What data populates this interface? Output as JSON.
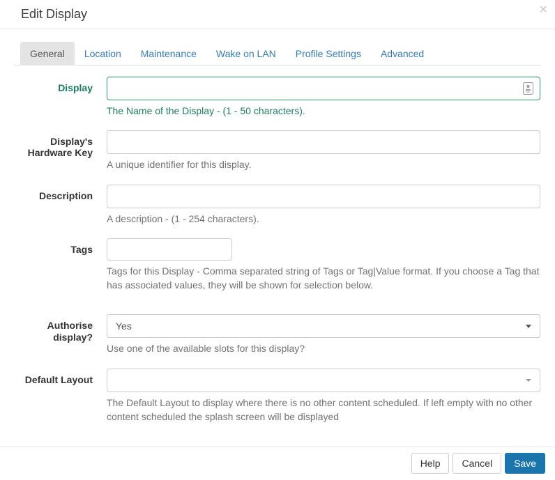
{
  "modal": {
    "title": "Edit Display",
    "close_glyph": "×"
  },
  "tabs": [
    {
      "label": "General",
      "active": true
    },
    {
      "label": "Location",
      "active": false
    },
    {
      "label": "Maintenance",
      "active": false
    },
    {
      "label": "Wake on LAN",
      "active": false
    },
    {
      "label": "Profile Settings",
      "active": false
    },
    {
      "label": "Advanced",
      "active": false
    }
  ],
  "form": {
    "fields": [
      {
        "id": "display",
        "label": "Display",
        "type": "text",
        "value": "",
        "help": "The Name of the Display - (1 - 50 characters).",
        "state": "success",
        "icon": "autofill-person-icon"
      },
      {
        "id": "hardware_key",
        "label": "Display's Hardware Key",
        "type": "text",
        "value": "",
        "help": "A unique identifier for this display."
      },
      {
        "id": "description",
        "label": "Description",
        "type": "text",
        "value": "",
        "help": "A description - (1 - 254 characters)."
      },
      {
        "id": "tags",
        "label": "Tags",
        "type": "text",
        "value": "",
        "help": "Tags for this Display - Comma separated string of Tags or Tag|Value format. If you choose a Tag that has associated values, they will be shown for selection below."
      },
      {
        "id": "authorise",
        "label": "Authorise display?",
        "type": "select",
        "value": "Yes",
        "help": "Use one of the available slots for this display?"
      },
      {
        "id": "default_layout",
        "label": "Default Layout",
        "type": "select",
        "value": "",
        "help": "The Default Layout to display where there is no other content scheduled. If left empty with no other content scheduled the splash screen will be displayed"
      }
    ]
  },
  "footer": {
    "help_label": "Help",
    "cancel_label": "Cancel",
    "save_label": "Save"
  },
  "colors": {
    "tab_link": "#337ab7",
    "active_tab_bg": "#e4e4e4",
    "success_text": "#1e7c62",
    "success_border": "#2f9e68",
    "help_text": "#737373",
    "save_button": "#1a75ac",
    "input_border": "#cccccc"
  }
}
